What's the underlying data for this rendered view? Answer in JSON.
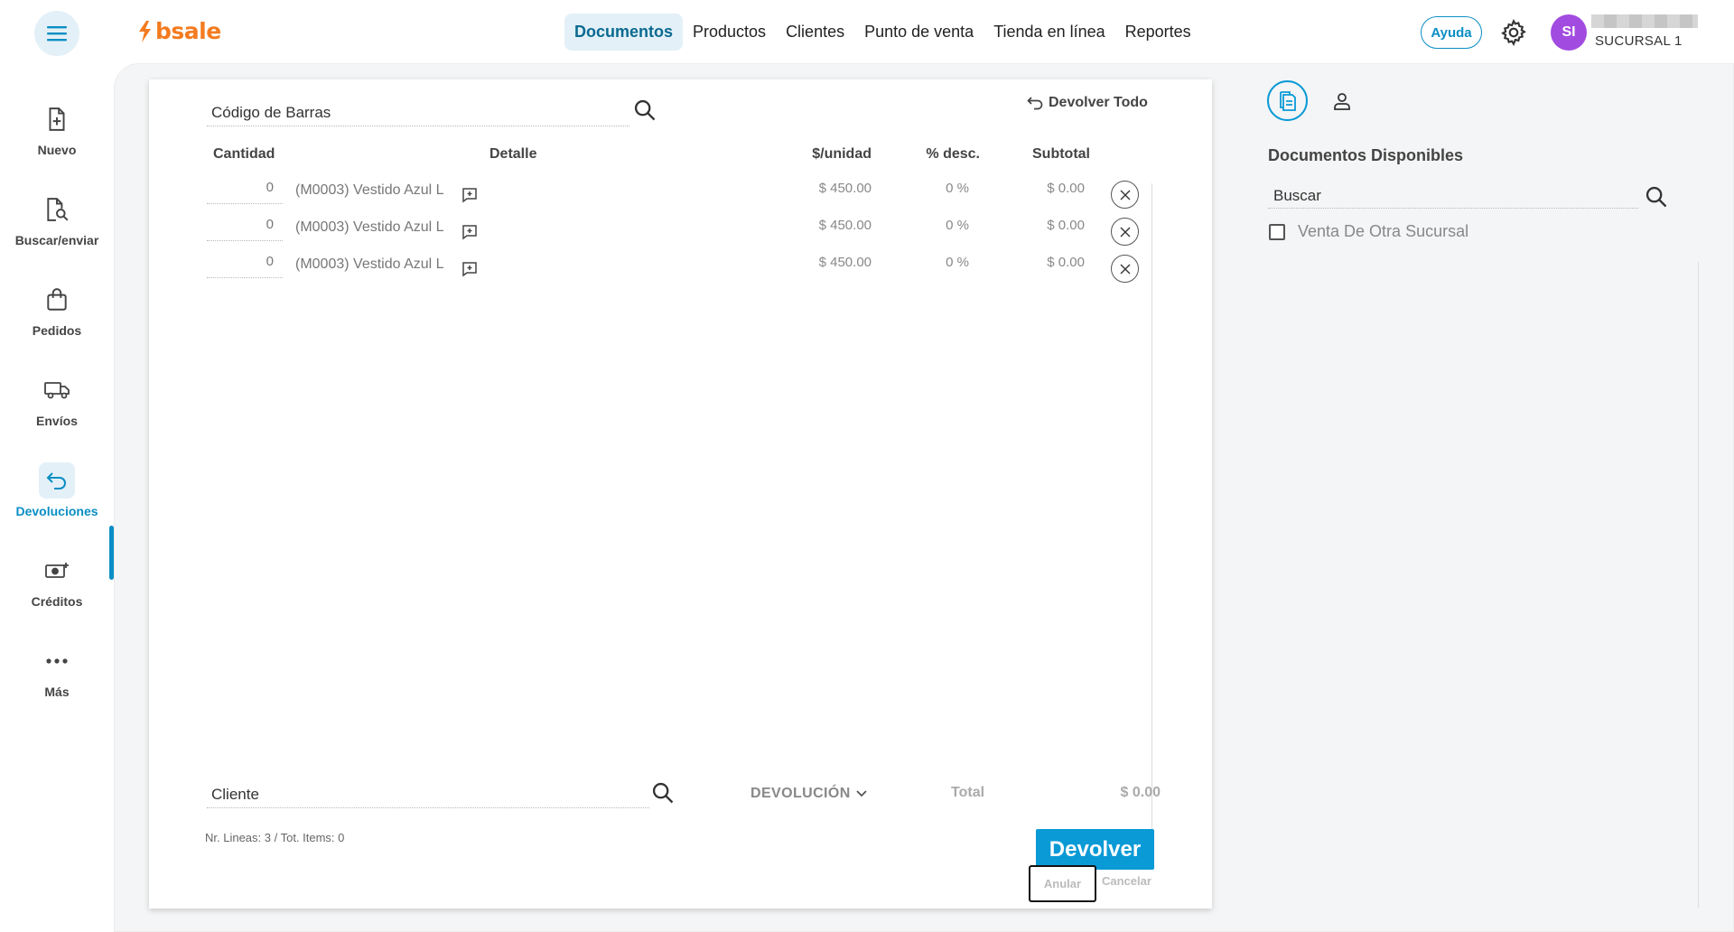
{
  "header": {
    "brand": "bsale",
    "nav": [
      "Documentos",
      "Productos",
      "Clientes",
      "Punto de venta",
      "Tienda en línea",
      "Reportes"
    ],
    "active_nav": "Documentos",
    "help_label": "Ayuda",
    "avatar_initials": "SI",
    "branch": "SUCURSAL 1",
    "accent_color": "#0a9ad6",
    "brand_color": "#f47b20",
    "avatar_color": "#a24be0"
  },
  "sidebar": {
    "items": [
      {
        "label": "Nuevo",
        "icon": "file-plus-icon"
      },
      {
        "label": "Buscar/enviar",
        "icon": "file-search-icon"
      },
      {
        "label": "Pedidos",
        "icon": "shopping-bag-icon"
      },
      {
        "label": "Envíos",
        "icon": "truck-icon"
      },
      {
        "label": "Devoluciones",
        "icon": "return-arrow-icon"
      },
      {
        "label": "Créditos",
        "icon": "money-plus-icon"
      },
      {
        "label": "Más",
        "icon": "more-dots-icon"
      }
    ],
    "active": "Devoluciones"
  },
  "document": {
    "barcode_placeholder": "Código de Barras",
    "return_all_label": "Devolver Todo",
    "columns": {
      "quantity": "Cantidad",
      "detail": "Detalle",
      "unit_price": "$/unidad",
      "discount": "% desc.",
      "subtotal": "Subtotal"
    },
    "rows": [
      {
        "qty": "0",
        "detail": "(M0003) Vestido Azul L",
        "price": "$ 450.00",
        "discount": "0 %",
        "subtotal": "$ 0.00"
      },
      {
        "qty": "0",
        "detail": "(M0003) Vestido Azul L",
        "price": "$ 450.00",
        "discount": "0 %",
        "subtotal": "$ 0.00"
      },
      {
        "qty": "0",
        "detail": "(M0003) Vestido Azul L",
        "price": "$ 450.00",
        "discount": "0 %",
        "subtotal": "$ 0.00"
      }
    ],
    "client_placeholder": "Cliente",
    "doc_type": "DEVOLUCIÓN",
    "total_label": "Total",
    "total_value": "$ 0.00",
    "lines_info": "Nr. Lineas: 3 / Tot. Items: 0",
    "return_button": "Devolver",
    "void_button": "Anular",
    "cancel_button": "Cancelar"
  },
  "right_panel": {
    "title": "Documentos Disponibles",
    "search_placeholder": "Buscar",
    "checkbox_label": "Venta De Otra Sucursal",
    "checkbox_checked": false
  }
}
